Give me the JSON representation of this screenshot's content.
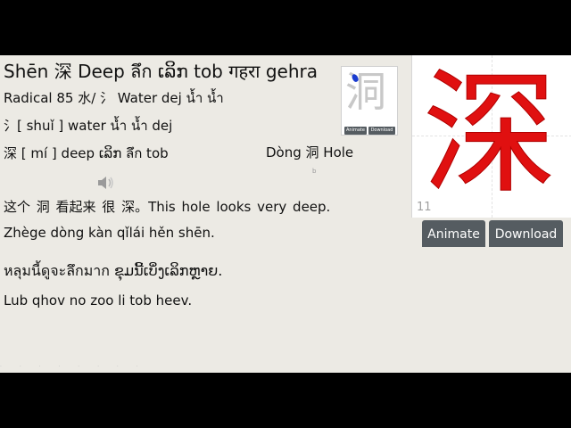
{
  "lesson": {
    "title": "Shēn 深 Deep ลึก ເລິກ tob गहरा  gehra",
    "radical_line": "Radical 85 水/ 氵 Water dej น้ำ น้ำ",
    "water_line": "氵[ shuǐ ] water น้ำ น้ำ dej",
    "deep_line": "深 [ mí ] deep ເລິກ ลึก tob",
    "hole_line": "Dòng 洞 Hole",
    "sentence_zh": "这个  洞  看起来 很 深。This hole looks very deep.",
    "sentence_pinyin": "Zhège dòng kàn qǐlái hěn shēn.",
    "sentence_thai_lao": "หลุมนี้ดูจะลึกมาก ຂຸມນີ້ເບິ່ງເລິກຫຼາຍ.",
    "sentence_hmong": "Lub qhov no zoo li tob heev."
  },
  "thumbnail": {
    "character": "洞",
    "animate_label": "Animate",
    "download_label": "Download"
  },
  "stroke_panel": {
    "character": "深",
    "stroke_count": "11",
    "animate_label": "Animate",
    "download_label": "Download"
  },
  "colors": {
    "character_red": "#e01010",
    "button_gray": "#555c61",
    "stroke_highlight": "#1a3cd0",
    "background": "#eceae4"
  },
  "icons": {
    "speaker": "speaker-icon"
  }
}
